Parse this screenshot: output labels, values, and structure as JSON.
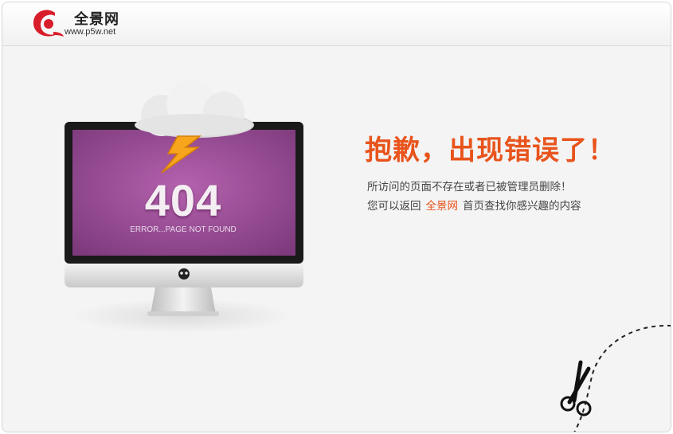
{
  "header": {
    "site_name": "全景网",
    "site_url": "www.p5w.net",
    "logo_icon": "p5w-logo-icon"
  },
  "error": {
    "code": "404",
    "subtitle": "ERROR...PAGE NOT FOUND"
  },
  "message": {
    "title": "抱歉，出现错误了！",
    "line1": "所访问的页面不存在或者已被管理员删除！",
    "line2_before": "您可以返回",
    "line2_link": "全景网",
    "line2_after": "首页查找你感兴趣的内容"
  },
  "icons": {
    "cloud": "cloud-icon",
    "lightning": "lightning-icon",
    "scissors": "scissors-icon",
    "monitor_logo": "skull-icon"
  },
  "colors": {
    "accent": "#e8541c",
    "screen": "#8b3d86"
  }
}
